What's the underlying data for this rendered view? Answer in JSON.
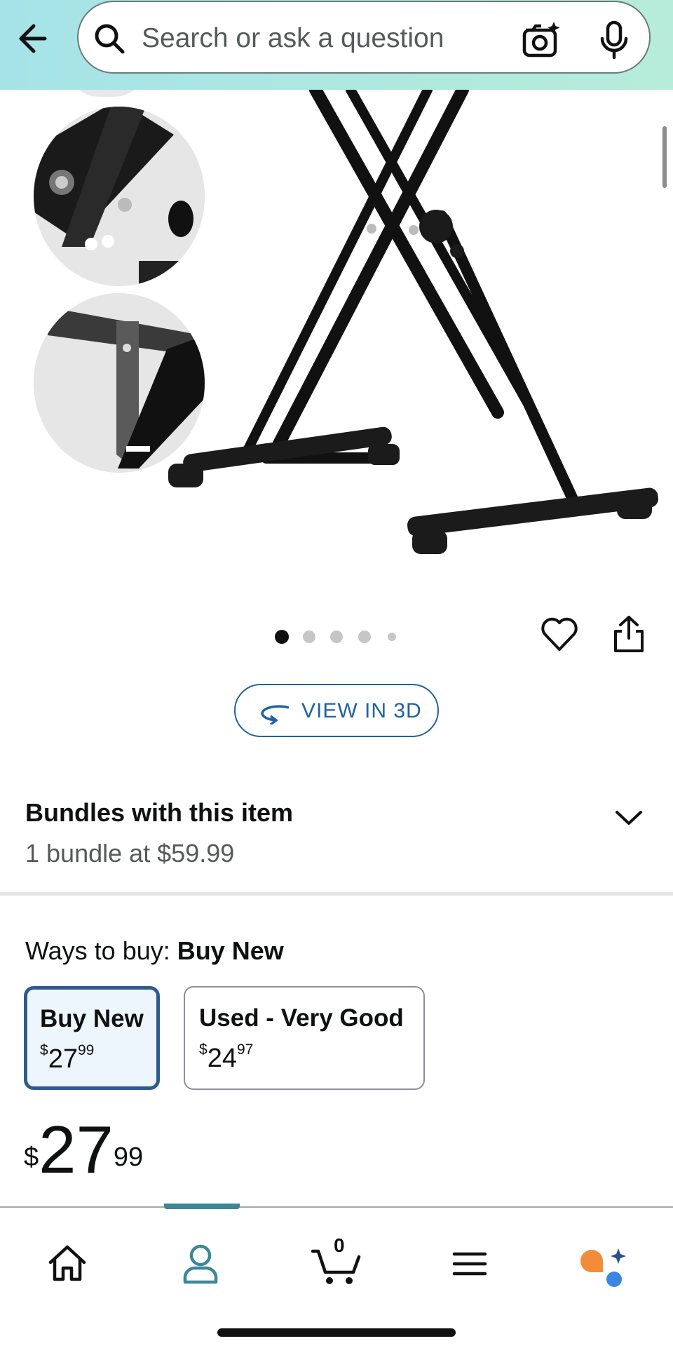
{
  "header": {
    "search_placeholder": "Search or ask a question",
    "icons": [
      "back-arrow-icon",
      "search-icon",
      "camera-sparkle-icon",
      "microphone-icon"
    ]
  },
  "gallery": {
    "image_count": 5,
    "active_index": 0
  },
  "actions": {
    "view_3d_label": "VIEW IN 3D"
  },
  "bundles": {
    "title": "Bundles with this item",
    "subtitle": "1 bundle at $59.99"
  },
  "ways_to_buy": {
    "label": "Ways to buy:",
    "selected": "Buy New",
    "options": [
      {
        "title": "Buy New",
        "currency": "$",
        "whole": "27",
        "fraction": "99"
      },
      {
        "title": "Used - Very Good",
        "currency": "$",
        "whole": "24",
        "fraction": "97"
      }
    ]
  },
  "price": {
    "currency": "$",
    "whole": "27",
    "fraction": "99"
  },
  "bottom_nav": {
    "cart_count": "0",
    "items": [
      "home-icon",
      "account-icon",
      "cart-icon",
      "menu-icon",
      "rufus-icon"
    ],
    "active": "account-icon"
  },
  "colors": {
    "accent": "#2162a1",
    "header_bg": "#a6e3e8",
    "nav_active": "#3c8797"
  }
}
